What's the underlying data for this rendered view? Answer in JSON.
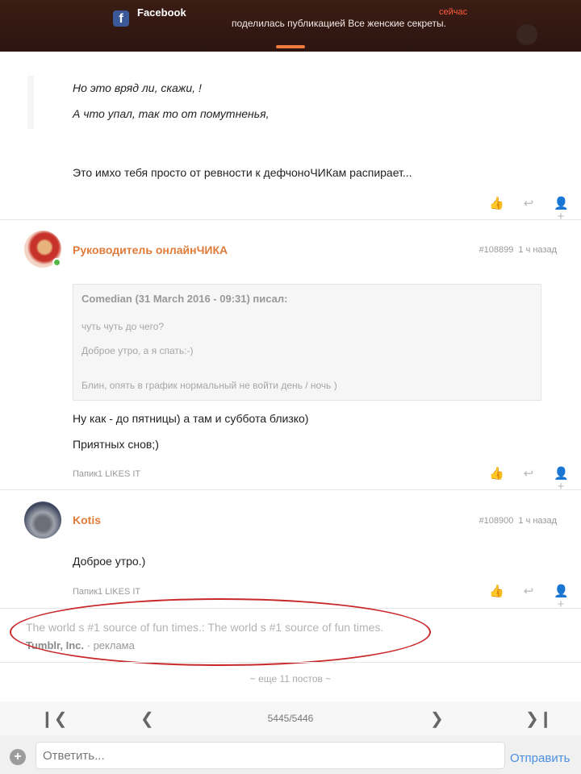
{
  "notification": {
    "app": "Facebook",
    "icon": "facebook-icon",
    "time": "сейчас",
    "message": "поделилась публикацией Все женские секреты.",
    "time_color": "#ff5b3d"
  },
  "post_top": {
    "lines_italic": [
      "Но это вряд ли, скажи,             !",
      "А что упал, так то от помутненья,"
    ],
    "line": "Это имхо тебя просто от ревности к дефчоноЧИКам распирает..."
  },
  "post_1": {
    "author": "Руководитель онлайнЧИКА",
    "number": "#108899",
    "time": "1 ч назад",
    "quote": {
      "header": "Comedian (31 March 2016 - 09:31) писал:",
      "lines": [
        "чуть чуть до чего?",
        "Доброе утро, а я спать:-)",
        "Блин, опять в график нормальный не войти день / ночь )"
      ]
    },
    "text": [
      "Ну как - до пятницы) а там и суббота близко)",
      "Приятных снов;)"
    ],
    "likes": "Папик1 LIKES IT"
  },
  "post_2": {
    "author": "Kotis",
    "number": "#108900",
    "time": "1 ч назад",
    "text": "Доброе утро.)",
    "likes": "Папик1 LIKES IT"
  },
  "ad": {
    "title": "The world s #1 source of fun times.: The world s #1 source of fun times.",
    "source": "Tumblr, Inc.",
    "label": "реклама"
  },
  "more_posts": "~ еще 11 постов ~",
  "pager": {
    "current": "5445/5446"
  },
  "composer": {
    "placeholder": "Ответить...",
    "send": "Отправить"
  },
  "colors": {
    "author": "#e07b39",
    "accent_link": "#4a90e2",
    "annotation": "#c9282a"
  }
}
